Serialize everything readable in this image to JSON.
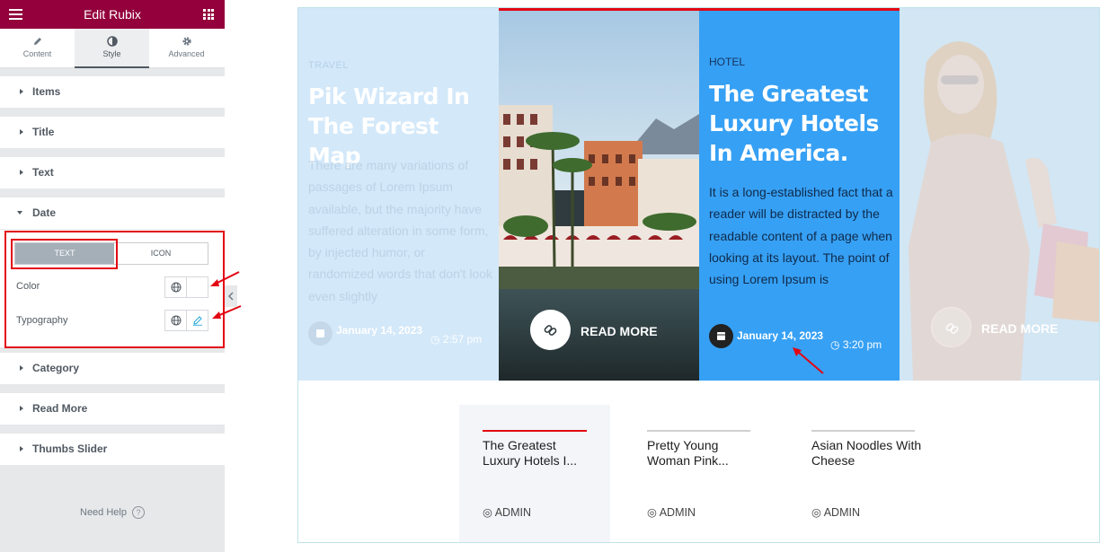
{
  "panel": {
    "title": "Edit Rubix",
    "tabs": [
      {
        "label": "Content",
        "icon": "pencil-icon"
      },
      {
        "label": "Style",
        "icon": "half-circle-icon",
        "active": true
      },
      {
        "label": "Advanced",
        "icon": "gear-icon"
      }
    ],
    "sections": [
      "Items",
      "Title",
      "Text",
      "Date",
      "Category",
      "Read More",
      "Thumbs Slider"
    ],
    "open_section": "Date",
    "date": {
      "toggle": [
        "TEXT",
        "ICON"
      ],
      "active_toggle": "TEXT",
      "color_label": "Color",
      "typography_label": "Typography"
    },
    "need_help": "Need Help",
    "help_glyph": "?"
  },
  "preview": {
    "slides": [
      {
        "category": "TRAVEL",
        "title": "Pik Wizard In The Forest Map",
        "text": "There are many variations of passages of Lorem Ipsum available, but the majority have suffered alteration in some form, by injected humor, or randomized words that don't look even slightly",
        "date": "January 14, 2023",
        "time": "2:57 pm"
      },
      {
        "read_more": "READ MORE",
        "image": "hotel-pool-photo"
      },
      {
        "category": "HOTEL",
        "title": "The Greatest Luxury Hotels In America.",
        "text": "It is a long-established fact that a reader will be distracted by the readable content of a page when looking at its layout. The point of using Lorem Ipsum is",
        "date": "January 14, 2023",
        "time": "3:20 pm"
      },
      {
        "read_more": "READ MORE",
        "image": "woman-shopping-photo"
      }
    ],
    "thumbs": [
      {
        "title": "The Greatest Luxury Hotels I...",
        "author": "ADMIN",
        "active": true
      },
      {
        "title": "Pretty Young Woman Pink...",
        "author": "ADMIN"
      },
      {
        "title": "Asian Noodles With Cheese",
        "author": "ADMIN"
      }
    ]
  },
  "colors": {
    "panel_header": "#93003c",
    "highlight": "#e30613",
    "active_slide": "#36a0f4"
  }
}
